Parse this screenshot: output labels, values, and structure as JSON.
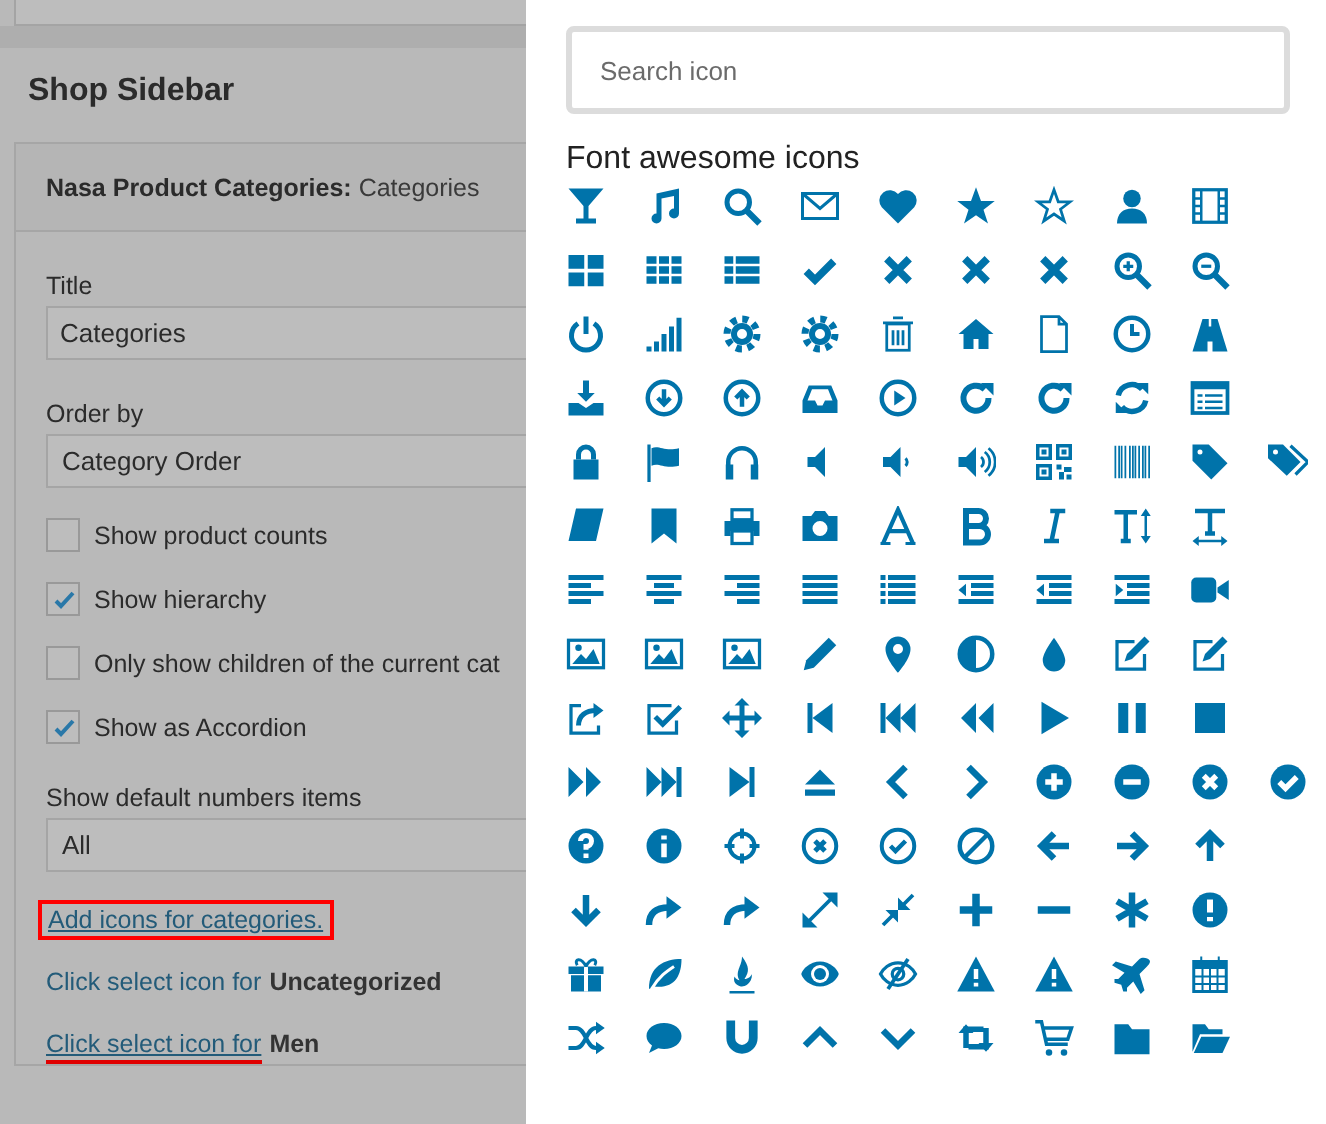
{
  "sidebar_area": {
    "heading": "Shop Sidebar"
  },
  "widget": {
    "name": "Nasa Product Categories:",
    "title_suffix": "Categories"
  },
  "fields": [
    {
      "kind": "input",
      "label": "Title",
      "value": "Categories"
    },
    {
      "kind": "select",
      "label": "Order by",
      "value": "Category Order"
    }
  ],
  "options": [
    {
      "label": "Show product counts",
      "checked": false
    },
    {
      "label": "Show hierarchy",
      "checked": true
    },
    {
      "label": "Only show children of the current cat",
      "checked": false
    },
    {
      "label": "Show as Accordion",
      "checked": true
    }
  ],
  "numbers_field": {
    "label": "Show default numbers items",
    "value": "All"
  },
  "add_icons_link": {
    "text": "Add icons for categories.",
    "highlighted": true
  },
  "category_links": [
    {
      "prefix": "Click select icon for",
      "category": "Uncategorized",
      "underlined": false
    },
    {
      "prefix": "Click select icon for",
      "category": "Men",
      "underlined": true
    }
  ],
  "icon_picker": {
    "search": {
      "placeholder": "Search icon"
    },
    "heading": "Font awesome icons"
  }
}
